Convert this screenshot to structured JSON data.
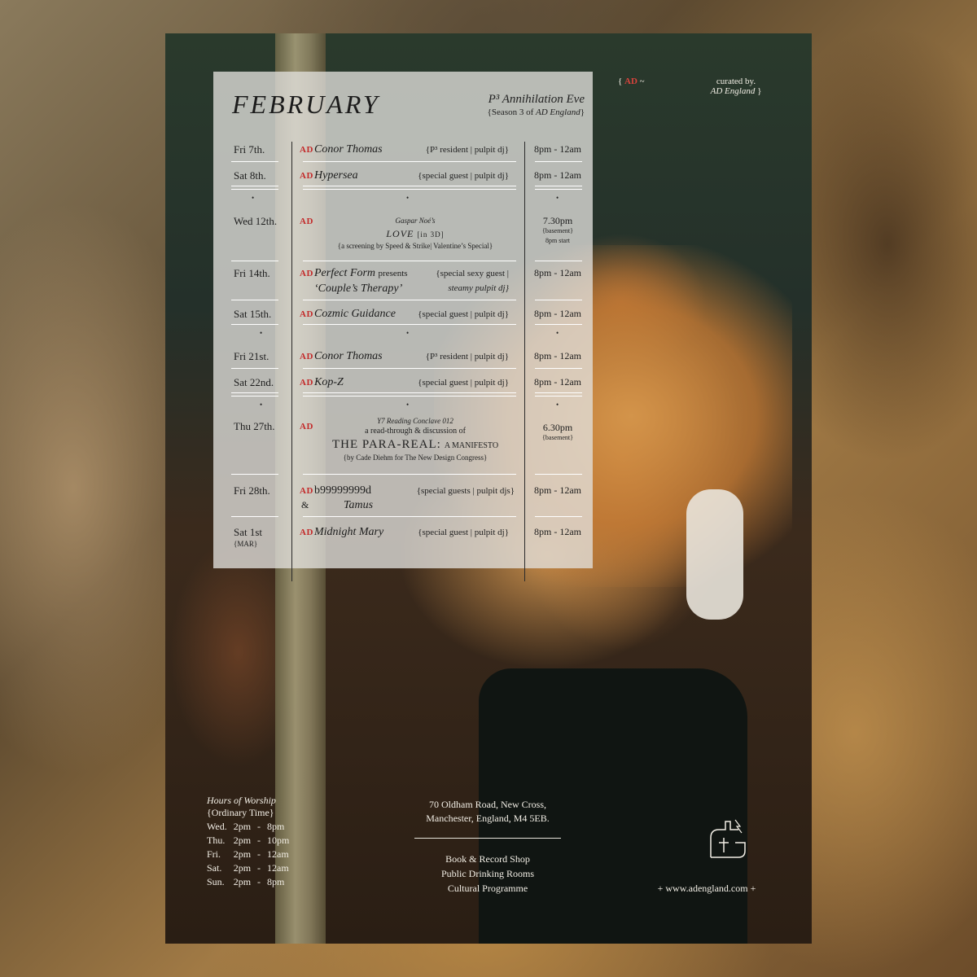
{
  "panel": {
    "month": "FEBRUARY",
    "series_title": "P³ Annihilation Eve",
    "series_sub_prefix": "{Season 3 of ",
    "series_sub_italic": "AD England",
    "series_sub_suffix": "}"
  },
  "ad_mark": "AD",
  "bullet": "•",
  "events": [
    {
      "date": "Fri 7th.",
      "act": "Conor Thomas",
      "role": "{P³ resident | pulpit dj}",
      "time": "8pm - 12am"
    },
    {
      "date": "Sat 8th.",
      "act": "Hypersea",
      "role": "{special guest | pulpit dj}",
      "time": "8pm - 12am"
    },
    {
      "date": "Wed 12th.",
      "pre": "Gaspar Noé’s",
      "main": "LOVE",
      "main_suffix": "[in 3D]",
      "note": "{a screening by Speed & Strike| Valentine’s Special}",
      "time": "7.30pm",
      "time_note": "{basement}",
      "time_note2": "8pm start"
    },
    {
      "date": "Fri 14th.",
      "act": "Perfect Form",
      "act_suffix": "presents",
      "act_line2": "‘Couple’s Therapy’",
      "role_line1": "{special sexy guest |",
      "role_line2": "steamy pulpit dj}",
      "time": "8pm - 12am"
    },
    {
      "date": "Sat 15th.",
      "act": "Cozmic Guidance",
      "role": "{special guest | pulpit dj}",
      "time": "8pm - 12am"
    },
    {
      "date": "Fri 21st.",
      "act": "Conor Thomas",
      "role": "{P³ resident | pulpit dj}",
      "time": "8pm - 12am"
    },
    {
      "date": "Sat 22nd.",
      "act": "Kop-Z",
      "role": "{special guest | pulpit dj}",
      "time": "8pm - 12am"
    },
    {
      "date": "Thu 27th.",
      "pre": "Y7 Reading Conclave 012",
      "mid": "a read-through & discussion of",
      "main": "THE PARA-REAL:",
      "main_suffix": "A MANIFESTO",
      "note": "{by Cade Diehm for The New Design Congress}",
      "time": "6.30pm",
      "time_note": "{basement}"
    },
    {
      "date": "Fri 28th.",
      "act": "b99999999d",
      "act_line2_prefix": "&",
      "act_line2": "Tamus",
      "role": "{special guests | pulpit djs}",
      "time": "8pm - 12am"
    },
    {
      "date": "Sat 1st",
      "date_note": "{MAR}",
      "act": "Midnight Mary",
      "role": "{special guest | pulpit dj}",
      "time": "8pm - 12am"
    }
  ],
  "header_right": {
    "ad_open": "{",
    "ad_mark": "AD",
    "ad_tilde": "~",
    "curated_by": "curated by.",
    "curator": "AD England",
    "curator_close": "}"
  },
  "hours": {
    "title": "Hours of Worship",
    "subtitle": "{Ordinary Time}",
    "rows": [
      {
        "day": "Wed.",
        "open": "2pm",
        "sep": "-",
        "close": "8pm"
      },
      {
        "day": "Thu.",
        "open": "2pm",
        "sep": "-",
        "close": "10pm"
      },
      {
        "day": "Fri.",
        "open": "2pm",
        "sep": "-",
        "close": "12am"
      },
      {
        "day": "Sat.",
        "open": "2pm",
        "sep": "-",
        "close": "12am"
      },
      {
        "day": "Sun.",
        "open": "2pm",
        "sep": "-",
        "close": "8pm"
      }
    ]
  },
  "address": {
    "line1": "70 Oldham Road, New Cross,",
    "line2": "Manchester, England, M4 5EB."
  },
  "services": [
    "Book & Record Shop",
    "Public Drinking Rooms",
    "Cultural Programme"
  ],
  "website": "+ www.adengland.com +",
  "colors": {
    "accent_red": "#c32a2a",
    "panel": "#e2e0dc",
    "ink": "#1c1c1c"
  }
}
